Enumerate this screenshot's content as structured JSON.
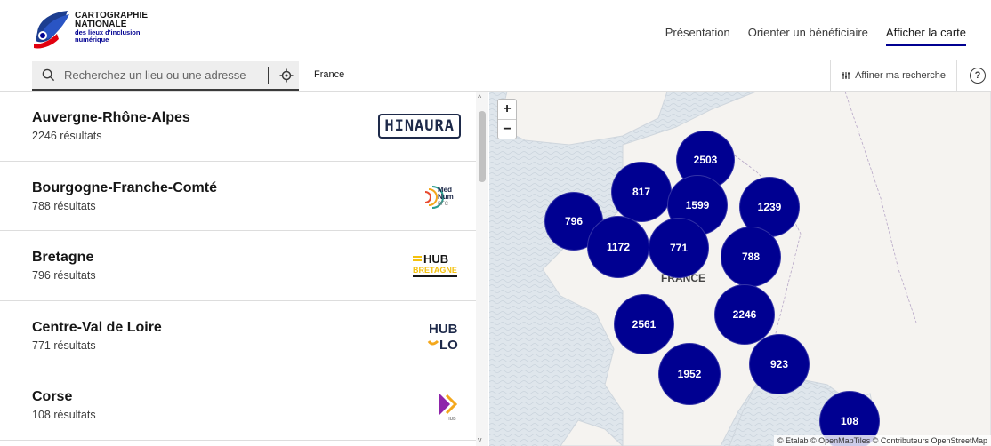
{
  "brand": {
    "line1": "CARTOGRAPHIE",
    "line2": "NATIONALE",
    "line3": "des lieux d'inclusion",
    "line4": "numérique"
  },
  "nav": [
    {
      "label": "Présentation",
      "active": false
    },
    {
      "label": "Orienter un bénéficiaire",
      "active": false
    },
    {
      "label": "Afficher la carte",
      "active": true
    }
  ],
  "search": {
    "placeholder": "Recherchez un lieu ou une adresse",
    "breadcrumb": "France",
    "refine_label": "Affiner ma recherche",
    "help_label": "?"
  },
  "regions": [
    {
      "name": "Auvergne-Rhône-Alpes",
      "count": "2246 résultats",
      "logo": "HINAURA"
    },
    {
      "name": "Bourgogne-Franche-Comté",
      "count": "788 résultats",
      "logo": "Med Num BFC"
    },
    {
      "name": "Bretagne",
      "count": "796 résultats",
      "logo": "HUB BRETAGNE"
    },
    {
      "name": "Centre-Val de Loire",
      "count": "771 résultats",
      "logo": "HUB LO"
    },
    {
      "name": "Corse",
      "count": "108 résultats",
      "logo": "HUB CORSE"
    }
  ],
  "map": {
    "zoom_in": "+",
    "zoom_out": "−",
    "country_label": "FRANCE",
    "attribution": "© Etalab © OpenMapTiles © Contributeurs OpenStreetMap",
    "clusters": [
      "2503",
      "817",
      "1599",
      "1239",
      "796",
      "1172",
      "771",
      "788",
      "2561",
      "2246",
      "1952",
      "923",
      "108"
    ]
  },
  "colors": {
    "primary": "#000091",
    "sea": "#dfe6ec",
    "land": "#f5f3f0"
  }
}
